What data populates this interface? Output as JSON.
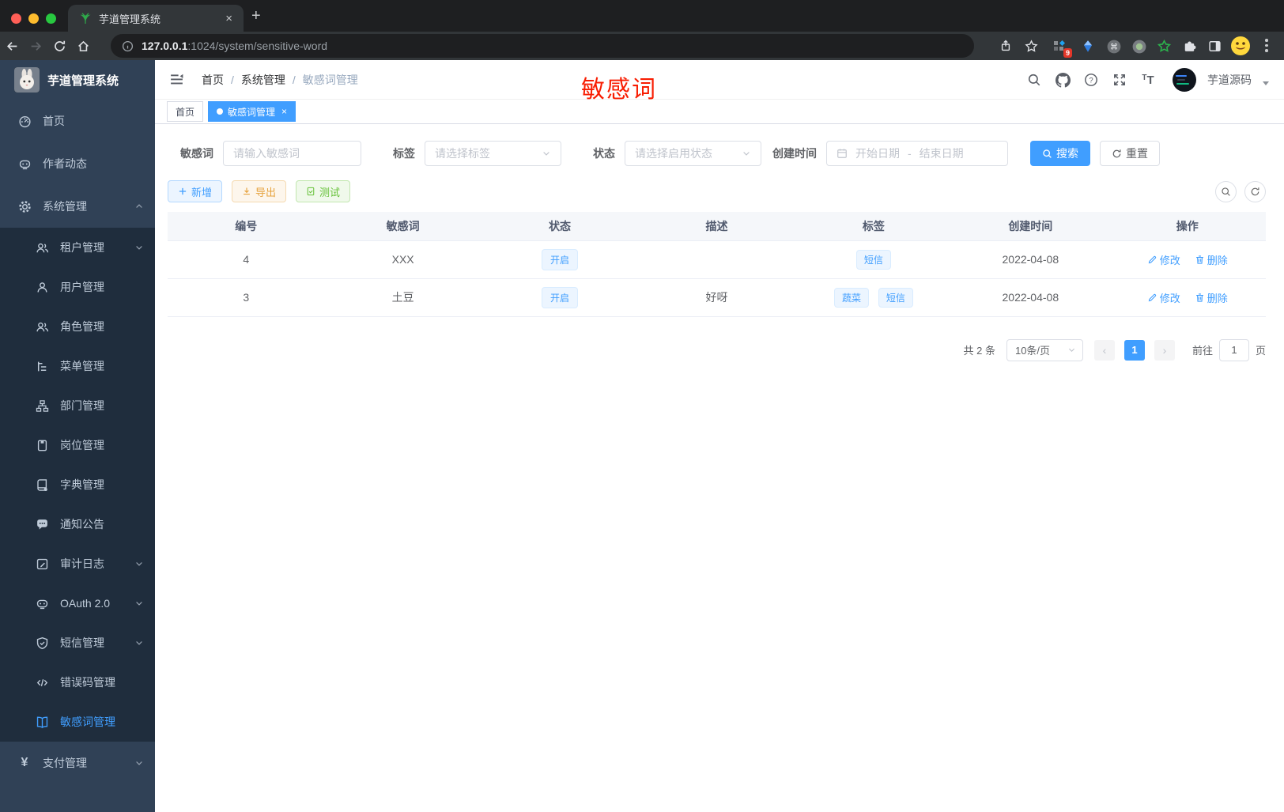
{
  "browser": {
    "tab_title": "芋道管理系统",
    "url_host": "127.0.0.1",
    "url_path": ":1024/system/sensitive-word",
    "extension_badge": "9",
    "new_tab_glyph": "+",
    "tab_close_glyph": "×"
  },
  "app": {
    "title": "芋道管理系统",
    "user_name": "芋道源码",
    "annotation": "敏感词",
    "breadcrumb": {
      "home": "首页",
      "parent": "系统管理",
      "current": "敏感词管理"
    },
    "crumb_sep": "/",
    "tabs": {
      "home": "首页",
      "current": "敏感词管理",
      "close_glyph": "×"
    }
  },
  "sidebar": {
    "items": [
      {
        "label": "首页"
      },
      {
        "label": "作者动态"
      },
      {
        "label": "系统管理"
      },
      {
        "label": "租户管理"
      },
      {
        "label": "用户管理"
      },
      {
        "label": "角色管理"
      },
      {
        "label": "菜单管理"
      },
      {
        "label": "部门管理"
      },
      {
        "label": "岗位管理"
      },
      {
        "label": "字典管理"
      },
      {
        "label": "通知公告"
      },
      {
        "label": "审计日志"
      },
      {
        "label": "OAuth 2.0"
      },
      {
        "label": "短信管理"
      },
      {
        "label": "错误码管理"
      },
      {
        "label": "敏感词管理"
      },
      {
        "label": "支付管理"
      }
    ]
  },
  "filters": {
    "word_label": "敏感词",
    "word_placeholder": "请输入敏感词",
    "tag_label": "标签",
    "tag_placeholder": "请选择标签",
    "status_label": "状态",
    "status_placeholder": "请选择启用状态",
    "time_label": "创建时间",
    "time_start": "开始日期",
    "time_sep": "-",
    "time_end": "结束日期",
    "search": "搜索",
    "reset": "重置"
  },
  "toolbar": {
    "add": "新增",
    "export": "导出",
    "test": "测试"
  },
  "table": {
    "headers": [
      "编号",
      "敏感词",
      "状态",
      "描述",
      "标签",
      "创建时间",
      "操作"
    ],
    "rows": [
      {
        "id": "4",
        "word": "XXX",
        "status": "开启",
        "desc": "",
        "tags": [
          "短信"
        ],
        "created": "2022-04-08",
        "edit": "修改",
        "delete": "删除"
      },
      {
        "id": "3",
        "word": "土豆",
        "status": "开启",
        "desc": "好呀",
        "tags": [
          "蔬菜",
          "短信"
        ],
        "created": "2022-04-08",
        "edit": "修改",
        "delete": "删除"
      }
    ]
  },
  "pagination": {
    "total": "共 2 条",
    "page_size": "10条/页",
    "prev_glyph": "‹",
    "next_glyph": "›",
    "current_page": "1",
    "goto_label": "前往",
    "goto_value": "1",
    "unit": "页"
  },
  "glyphs": {
    "cmd": "⌘",
    "yen": "¥",
    "code": "</>",
    "help": "?",
    "t_small": "T",
    "t_big": "T"
  },
  "colors": {
    "accent": "#409eff",
    "warning": "#e6a23c",
    "success": "#67c23a",
    "annotation_red": "#f81d02",
    "sidebar_bg": "#304156",
    "submenu_bg": "#1f2d3d"
  }
}
